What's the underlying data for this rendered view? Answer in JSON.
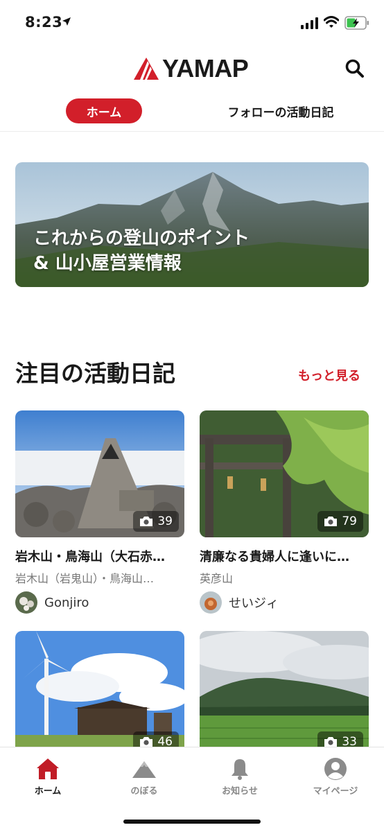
{
  "status_bar": {
    "time": "8:23"
  },
  "header": {
    "logo_text": "YAMAP",
    "tabs": [
      {
        "label": "ホーム",
        "active": true
      },
      {
        "label": "フォローの活動日記",
        "active": false
      }
    ]
  },
  "hero": {
    "line1": "これからの登山のポイント",
    "line2": "& 山小屋営業情報"
  },
  "featured": {
    "title": "注目の活動日記",
    "more_label": "もっと見る",
    "cards": [
      {
        "title": "岩木山・鳥海山（大石赤…",
        "mountain": "岩木山（岩鬼山）・鳥海山…",
        "user": "Gonjiro",
        "photos": "39"
      },
      {
        "title": "清廉なる貴婦人に逢いに…",
        "mountain": "英彦山",
        "user": "せいジィ",
        "photos": "79"
      },
      {
        "photos": "46"
      },
      {
        "photos": "33"
      }
    ]
  },
  "tabbar": {
    "items": [
      {
        "label": "ホーム",
        "icon": "home-icon",
        "active": true
      },
      {
        "label": "のぼる",
        "icon": "mountain-icon",
        "active": false
      },
      {
        "label": "お知らせ",
        "icon": "bell-icon",
        "active": false
      },
      {
        "label": "マイページ",
        "icon": "person-icon",
        "active": false
      }
    ]
  },
  "colors": {
    "accent": "#d21f2a",
    "text": "#1a1a1a",
    "muted": "#777777"
  }
}
